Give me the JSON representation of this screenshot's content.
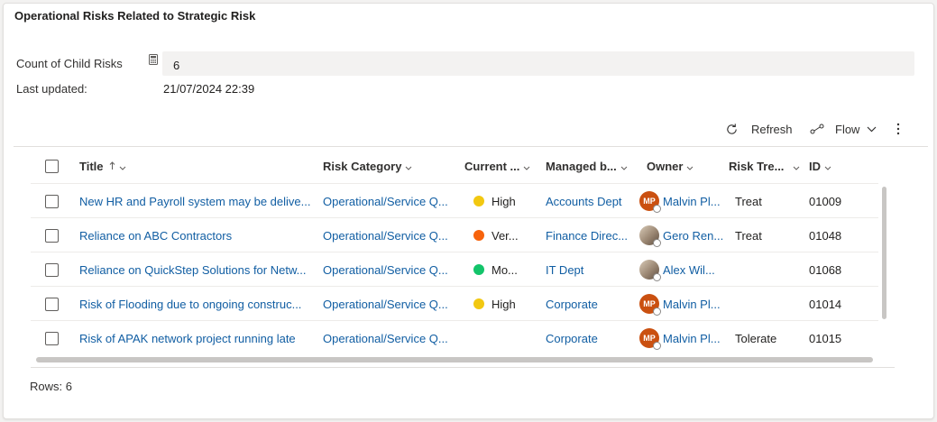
{
  "section": {
    "title": "Operational Risks Related to Strategic Risk"
  },
  "fields": {
    "count_label": "Count of Child Risks",
    "count_value": "6",
    "updated_label": "Last updated:",
    "updated_value": "21/07/2024 22:39"
  },
  "commands": {
    "refresh": "Refresh",
    "flow": "Flow"
  },
  "columns": {
    "title": "Title",
    "category": "Risk Category",
    "current": "Current ...",
    "managed": "Managed b...",
    "owner": "Owner",
    "treatment": "Risk Tre...",
    "id": "ID"
  },
  "rows": [
    {
      "title": "New HR and Payroll system may be delive...",
      "category": "Operational/Service Q...",
      "current": "High",
      "current_color": "#f2c811",
      "managed": "Accounts Dept",
      "owner": "Malvin Pl...",
      "owner_initials": "MP",
      "owner_avatar": "initials",
      "treatment": "Treat",
      "id": "01009"
    },
    {
      "title": "Reliance on ABC Contractors",
      "category": "Operational/Service Q...",
      "current": "Ver...",
      "current_color": "#f7630c",
      "managed": "Finance Direc...",
      "owner": "Gero Ren...",
      "owner_initials": "",
      "owner_avatar": "photo",
      "treatment": "Treat",
      "id": "01048"
    },
    {
      "title": "Reliance on QuickStep Solutions for Netw...",
      "category": "Operational/Service Q...",
      "current": "Mo...",
      "current_color": "#13c46a",
      "managed": "IT Dept",
      "owner": "Alex Wil...",
      "owner_initials": "",
      "owner_avatar": "photo",
      "treatment": "",
      "id": "01068"
    },
    {
      "title": "Risk of  Flooding due to ongoing construc...",
      "category": "Operational/Service Q...",
      "current": "High",
      "current_color": "#f2c811",
      "managed": "Corporate",
      "owner": "Malvin Pl...",
      "owner_initials": "MP",
      "owner_avatar": "initials",
      "treatment": "",
      "id": "01014"
    },
    {
      "title": "Risk of APAK network project running late",
      "category": "Operational/Service Q...",
      "current": "",
      "current_color": "",
      "managed": "Corporate",
      "owner": "Malvin Pl...",
      "owner_initials": "MP",
      "owner_avatar": "initials",
      "treatment": "Tolerate",
      "id": "01015"
    }
  ],
  "footer": {
    "rows_label": "Rows: 6"
  },
  "colors": {
    "link": "#115ea3",
    "avatar_mp": "#ca5010"
  }
}
